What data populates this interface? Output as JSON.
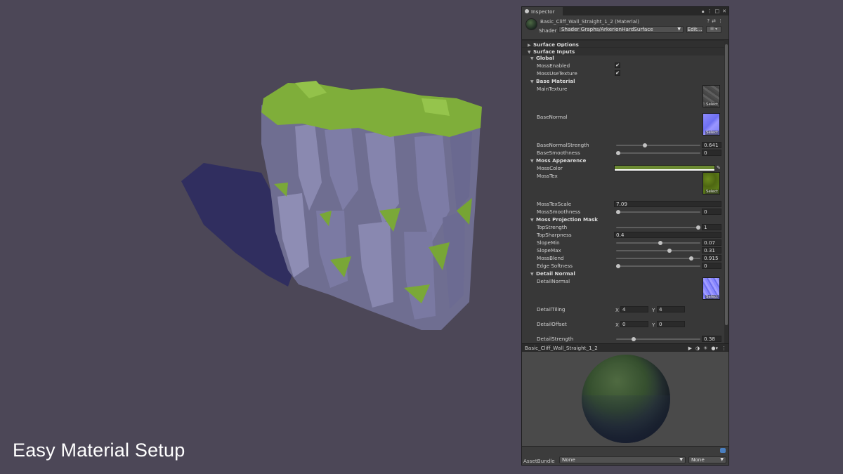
{
  "caption": "Easy Material Setup",
  "inspector": {
    "tab_title": "Inspector",
    "material_name": "Basic_Cliff_Wall_Straight_1_2 (Material)",
    "shader_label": "Shader",
    "shader_value": "Shader Graphs/ArkerionHardSurface",
    "edit_label": "Edit...",
    "sections": {
      "surface_options": "Surface Options",
      "surface_inputs": "Surface Inputs",
      "global": "Global",
      "base_material": "Base Material",
      "moss_appearance": "Moss Appearence",
      "moss_projection": "Moss Projection Mask",
      "detail_normal": "Detail Normal"
    },
    "props": {
      "moss_enabled": "MossEnabled",
      "moss_use_texture": "MossUseTexture",
      "main_texture": "MainTexture",
      "base_normal": "BaseNormal",
      "base_normal_strength": {
        "label": "BaseNormalStrength",
        "value": "0.641",
        "fraction": 0.33
      },
      "base_smoothness": {
        "label": "BaseSmoothness",
        "value": "0",
        "fraction": 0.0
      },
      "moss_color": {
        "label": "MossColor",
        "color": "#6b8a32"
      },
      "moss_tex": "MossTex",
      "moss_tex_scale": {
        "label": "MossTexScale",
        "value": "7.09"
      },
      "moss_smoothness": {
        "label": "MossSmoothness",
        "value": "0",
        "fraction": 0.0
      },
      "top_strength": {
        "label": "TopStrength",
        "value": "1",
        "fraction": 1.0
      },
      "top_sharpness": {
        "label": "TopSharpness",
        "value": "0.4"
      },
      "slope_min": {
        "label": "SlopeMin",
        "value": "0.07",
        "fraction": 0.53
      },
      "slope_max": {
        "label": "SlopeMax",
        "value": "0.31",
        "fraction": 0.64
      },
      "moss_blend": {
        "label": "MossBlend",
        "value": "0.915",
        "fraction": 0.915
      },
      "edge_softness": {
        "label": "Edge Softness",
        "value": "0",
        "fraction": 0.0
      },
      "detail_normal_tex": "DetailNormal",
      "detail_tiling": {
        "label": "DetailTiling",
        "x": "4",
        "y": "4"
      },
      "detail_offset": {
        "label": "DetailOffset",
        "x": "0",
        "y": "0"
      },
      "detail_strength": {
        "label": "DetailStrength",
        "value": "0.38",
        "fraction": 0.19
      }
    },
    "select_label": "Select",
    "x_label": "X",
    "y_label": "Y",
    "preview_name": "Basic_Cliff_Wall_Straight_1_2",
    "asset_bundle_label": "AssetBundle",
    "asset_bundle_value": "None",
    "asset_bundle_variant": "None"
  }
}
